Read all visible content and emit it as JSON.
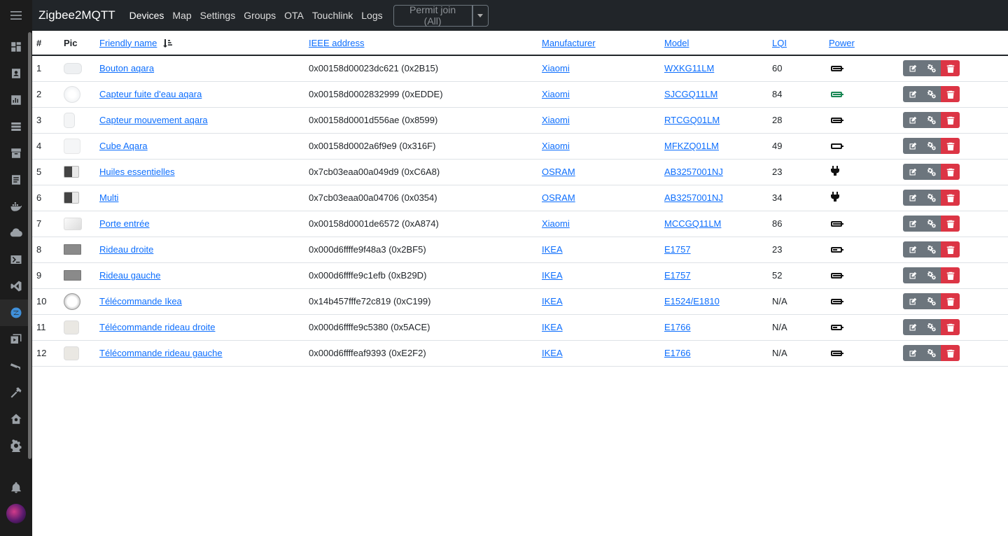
{
  "app": {
    "brand": "Zigbee2MQTT"
  },
  "nav": {
    "items": [
      {
        "label": "Devices",
        "active": true
      },
      {
        "label": "Map"
      },
      {
        "label": "Settings"
      },
      {
        "label": "Groups"
      },
      {
        "label": "OTA"
      },
      {
        "label": "Touchlink"
      },
      {
        "label": "Logs"
      }
    ],
    "permit_join_label": "Permit join (All)"
  },
  "sidebar": {
    "icons": [
      "dashboard-icon",
      "account-icon",
      "chart-icon",
      "storage-icon",
      "pack-icon",
      "list-icon",
      "docker-icon",
      "cloud-icon",
      "terminal-icon",
      "vscode-icon",
      "zigbee-icon",
      "media-icon",
      "camera-icon",
      "hammer-icon",
      "home-assistant-icon",
      "settings-icon"
    ],
    "active_icon": "zigbee-icon"
  },
  "table": {
    "headers": {
      "num": "#",
      "pic": "Pic",
      "friendly_name": "Friendly name",
      "ieee": "IEEE address",
      "manufacturer": "Manufacturer",
      "model": "Model",
      "lqi": "LQI",
      "power": "Power"
    },
    "rows": [
      {
        "num": "1",
        "name": "Bouton aqara",
        "ieee": "0x00158d00023dc621 (0x2B15)",
        "manufacturer": "Xiaomi",
        "model": "WXKG11LM",
        "lqi": "60",
        "power": "battery-full"
      },
      {
        "num": "2",
        "name": "Capteur fuite d'eau aqara",
        "ieee": "0x00158d0002832999 (0xEDDE)",
        "manufacturer": "Xiaomi",
        "model": "SJCGQ11LM",
        "lqi": "84",
        "power": "battery-full-green"
      },
      {
        "num": "3",
        "name": "Capteur mouvement aqara",
        "ieee": "0x00158d0001d556ae (0x8599)",
        "manufacturer": "Xiaomi",
        "model": "RTCGQ01LM",
        "lqi": "28",
        "power": "battery-full"
      },
      {
        "num": "4",
        "name": "Cube Aqara",
        "ieee": "0x00158d0002a6f9e9 (0x316F)",
        "manufacturer": "Xiaomi",
        "model": "MFKZQ01LM",
        "lqi": "49",
        "power": "battery-empty"
      },
      {
        "num": "5",
        "name": "Huiles essentielles",
        "ieee": "0x7cb03eaa00a049d9 (0xC6A8)",
        "manufacturer": "OSRAM",
        "model": "AB3257001NJ",
        "lqi": "23",
        "power": "plug"
      },
      {
        "num": "6",
        "name": "Multi",
        "ieee": "0x7cb03eaa00a04706 (0x0354)",
        "manufacturer": "OSRAM",
        "model": "AB3257001NJ",
        "lqi": "34",
        "power": "plug"
      },
      {
        "num": "7",
        "name": "Porte entrée",
        "ieee": "0x00158d0001de6572 (0xA874)",
        "manufacturer": "Xiaomi",
        "model": "MCCGQ11LM",
        "lqi": "86",
        "power": "battery-full"
      },
      {
        "num": "8",
        "name": "Rideau droite",
        "ieee": "0x000d6ffffe9f48a3 (0x2BF5)",
        "manufacturer": "IKEA",
        "model": "E1757",
        "lqi": "23",
        "power": "battery-half"
      },
      {
        "num": "9",
        "name": "Rideau gauche",
        "ieee": "0x000d6ffffe9c1efb (0xB29D)",
        "manufacturer": "IKEA",
        "model": "E1757",
        "lqi": "52",
        "power": "battery-full"
      },
      {
        "num": "10",
        "name": "Télécommande Ikea",
        "ieee": "0x14b457fffe72c819 (0xC199)",
        "manufacturer": "IKEA",
        "model": "E1524/E1810",
        "lqi": "N/A",
        "power": "battery-full"
      },
      {
        "num": "11",
        "name": "Télécommande rideau droite",
        "ieee": "0x000d6ffffe9c5380 (0x5ACE)",
        "manufacturer": "IKEA",
        "model": "E1766",
        "lqi": "N/A",
        "power": "battery-half"
      },
      {
        "num": "12",
        "name": "Télécommande rideau gauche",
        "ieee": "0x000d6ffffeaf9393 (0xE2F2)",
        "manufacturer": "IKEA",
        "model": "E1766",
        "lqi": "N/A",
        "power": "battery-full"
      }
    ]
  },
  "colors": {
    "link": "#0d6efd",
    "danger": "#dc3545",
    "secondary": "#6c757d",
    "topbar": "#212529",
    "sidebar": "#1c1c1c"
  }
}
